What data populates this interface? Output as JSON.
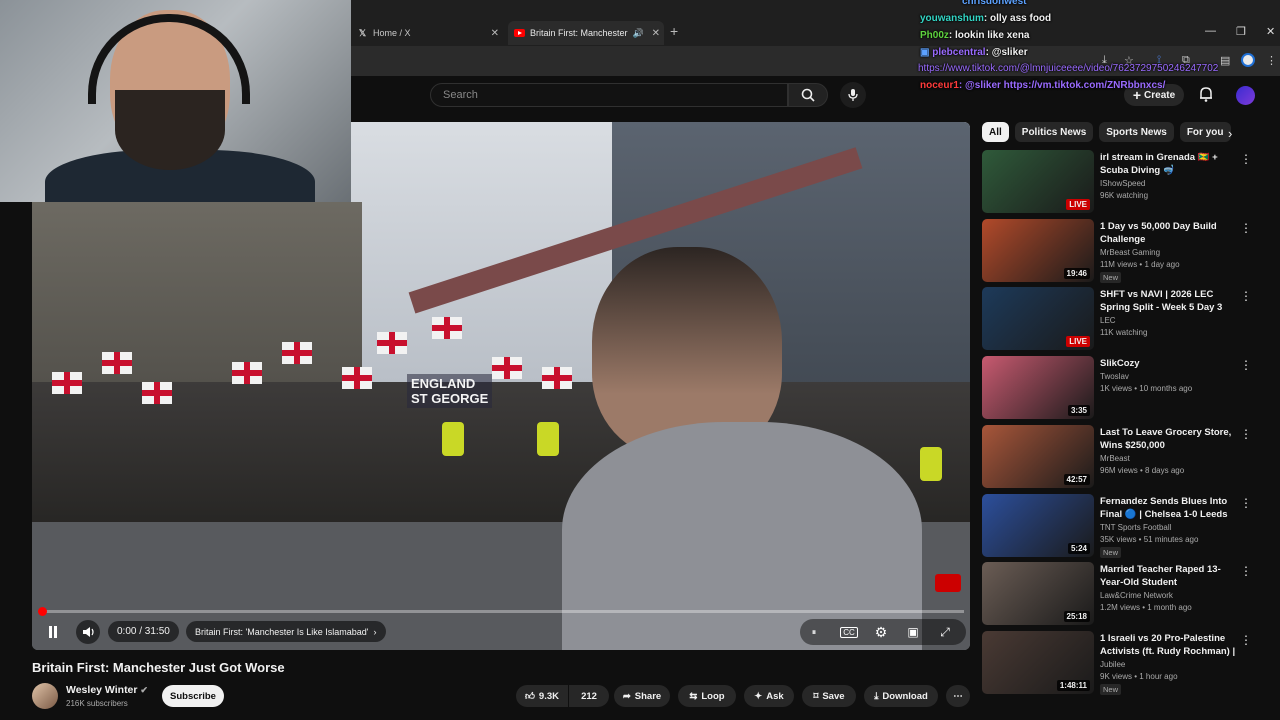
{
  "browser": {
    "tabs": [
      {
        "label": "Home / X",
        "icon": "x-logo-icon"
      },
      {
        "label": "Britain First: Manchester Ju",
        "icon": "youtube-icon"
      }
    ],
    "new_tab": "+"
  },
  "youtube": {
    "search_placeholder": "Search",
    "create_label": "Create"
  },
  "chat": [
    {
      "user": "chrisdonwest",
      "user_color": "#5da2ff",
      "text": ""
    },
    {
      "user": "youwanshum",
      "user_color": "#33d6c5",
      "text": ": olly ass food"
    },
    {
      "user": "Ph00z",
      "user_color": "#5fd43f",
      "text": ": lookin like xena"
    },
    {
      "user": "plebcentral",
      "user_color": "#9a6bff",
      "text": ": @sliker"
    },
    {
      "user": "",
      "user_color": "#9a6bff",
      "text": "https://www.tiktok.com/@lmnjuiceeee/video/7623729750246247702"
    },
    {
      "user": "noceur1",
      "user_color": "#ff3b3b",
      "text": ": @sliker https://vm.tiktok.com/ZNRbbnxcs/"
    }
  ],
  "video": {
    "banner_text": "ENGLAND\nST GEORGE",
    "time": "0:00 / 31:50",
    "chapter": "Britain First: 'Manchester Is Like Islamabad'",
    "progress": 0.0,
    "title": "Britain First: Manchester Just Got Worse",
    "channel": "Wesley Winter",
    "subscribers": "216K subscribers",
    "subscribe_label": "Subscribe",
    "likes": "9.3K",
    "comments": "212",
    "share_label": "Share",
    "loop_label": "Loop",
    "ask_label": "Ask",
    "save_label": "Save",
    "download_label": "Download"
  },
  "chips": [
    "All",
    "Politics News",
    "Sports News",
    "For you"
  ],
  "recommendations": [
    {
      "title": "irl stream in Grenada 🇬🇩 + Scuba Diving 🤿",
      "channel": "IShowSpeed",
      "meta": "96K watching",
      "badge": "",
      "duration": "",
      "live": "LIVE",
      "thumb": "#2f5a3a"
    },
    {
      "title": "1 Day vs 50,000 Day Build Challenge",
      "channel": "MrBeast Gaming",
      "meta": "11M views • 1 day ago",
      "badge": "New",
      "duration": "19:46",
      "live": "",
      "thumb": "#b24a2a"
    },
    {
      "title": "SHFT vs NAVI | 2026 LEC Spring Split - Week 5 Day 3",
      "channel": "LEC",
      "meta": "11K watching",
      "badge": "",
      "duration": "",
      "live": "LIVE",
      "thumb": "#1d3a5a"
    },
    {
      "title": "SlikCozy",
      "channel": "Twoslav",
      "meta": "1K views • 10 months ago",
      "badge": "",
      "duration": "3:35",
      "live": "",
      "thumb": "#c85a70"
    },
    {
      "title": "Last To Leave Grocery Store, Wins $250,000",
      "channel": "MrBeast",
      "meta": "96M views • 8 days ago",
      "badge": "",
      "duration": "42:57",
      "live": "",
      "thumb": "#a8563a"
    },
    {
      "title": "Fernandez Sends Blues Into Final 🔵 | Chelsea 1-0 Leeds ...",
      "channel": "TNT Sports Football",
      "meta": "35K views • 51 minutes ago",
      "badge": "New",
      "duration": "5:24",
      "live": "",
      "thumb": "#2c4f9c"
    },
    {
      "title": "Married Teacher Raped 13-Year-Old Student",
      "channel": "Law&Crime Network",
      "meta": "1.2M views • 1 month ago",
      "badge": "",
      "duration": "25:18",
      "live": "",
      "thumb": "#6b5d55"
    },
    {
      "title": "1 Israeli vs 20 Pro-Palestine Activists (ft. Rudy Rochman) | ...",
      "channel": "Jubilee",
      "meta": "9K views • 1 hour ago",
      "badge": "New",
      "duration": "1:48:11",
      "live": "",
      "thumb": "#4a3a34"
    }
  ]
}
